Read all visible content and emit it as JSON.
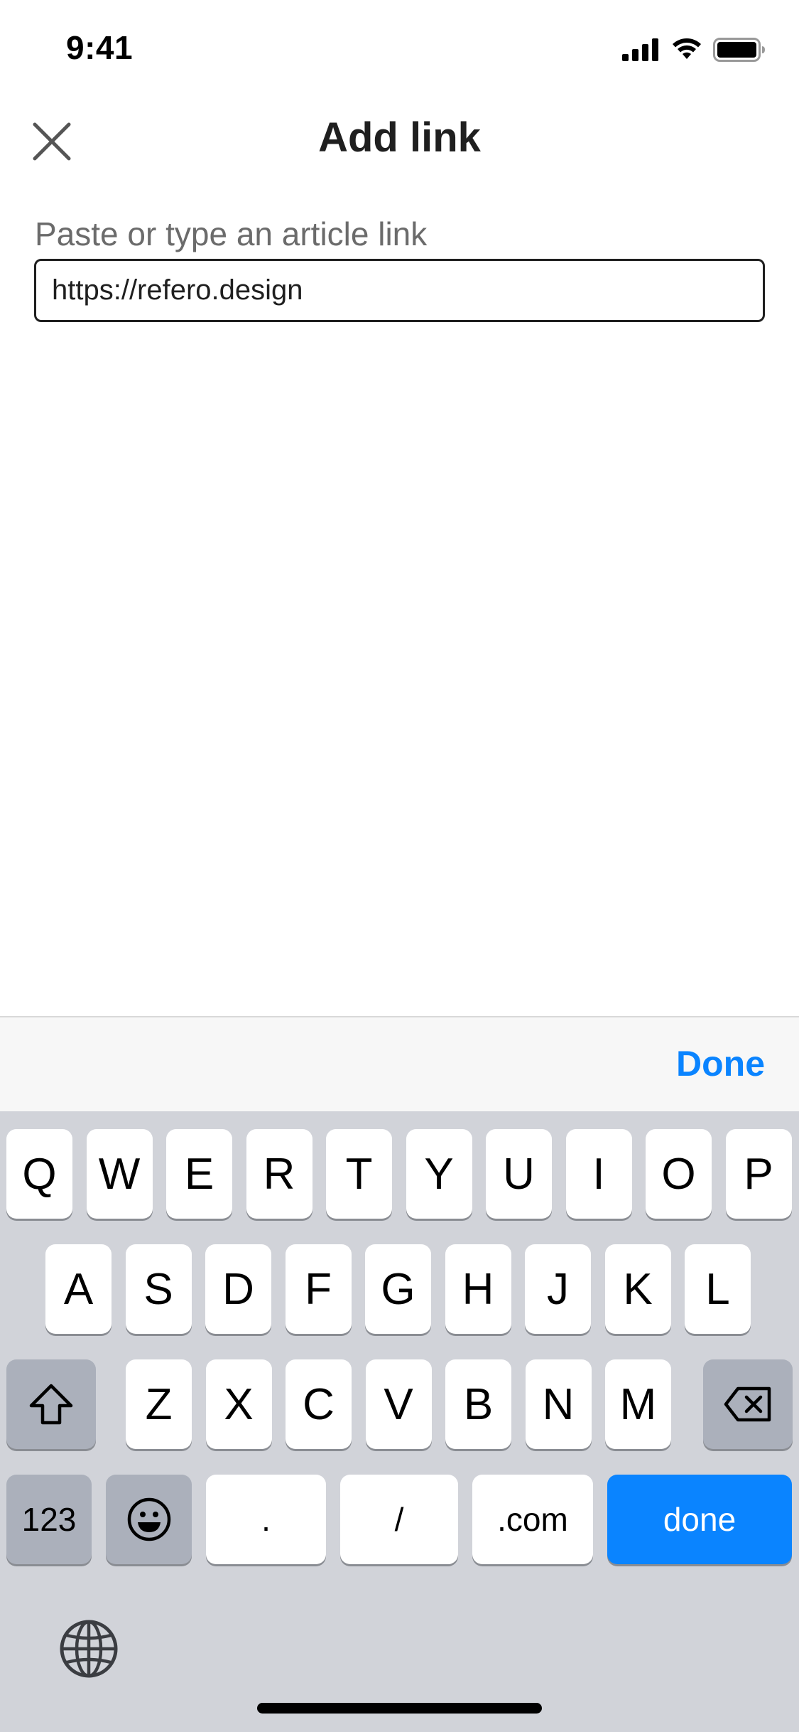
{
  "status_bar": {
    "time": "9:41"
  },
  "header": {
    "title": "Add link"
  },
  "form": {
    "label": "Paste or type an article link",
    "url_value": "https://refero.design"
  },
  "accessory": {
    "done_label": "Done"
  },
  "keyboard": {
    "row1": [
      "Q",
      "W",
      "E",
      "R",
      "T",
      "Y",
      "U",
      "I",
      "O",
      "P"
    ],
    "row2": [
      "A",
      "S",
      "D",
      "F",
      "G",
      "H",
      "J",
      "K",
      "L"
    ],
    "row3": [
      "Z",
      "X",
      "C",
      "V",
      "B",
      "N",
      "M"
    ],
    "numbers_label": "123",
    "period_label": ".",
    "slash_label": "/",
    "dotcom_label": ".com",
    "return_label": "done"
  },
  "colors": {
    "accent": "#0a84ff",
    "keyboard_bg": "#d1d3d9",
    "dark_key": "#abb0bb"
  }
}
